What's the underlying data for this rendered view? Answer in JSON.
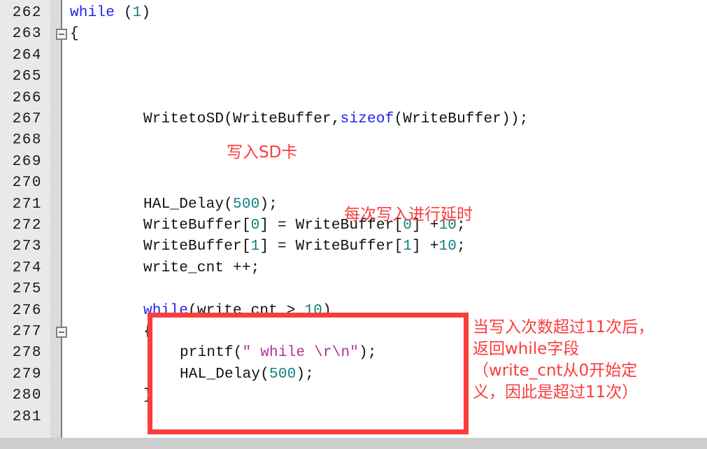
{
  "editor": {
    "gutter_bg": "#e9e9e9",
    "page_bg": "#ffffff",
    "annotation_color": "#fa3c3c",
    "keyword_color": "#2222ee",
    "number_color": "#108080",
    "string_color": "#b0309a",
    "scrollbar_color": "#cdcdcd",
    "line_numbers": [
      "262",
      "263",
      "264",
      "265",
      "266",
      "267",
      "268",
      "269",
      "270",
      "271",
      "272",
      "273",
      "274",
      "275",
      "276",
      "277",
      "278",
      "279",
      "280",
      "281"
    ],
    "fold_markers": [
      {
        "line": "263"
      },
      {
        "line": "277"
      }
    ],
    "lines": [
      {
        "num": "262",
        "indent": 0,
        "tokens": [
          {
            "t": "kw",
            "v": "while"
          },
          {
            "t": "plain",
            "v": " ("
          },
          {
            "t": "num",
            "v": "1"
          },
          {
            "t": "plain",
            "v": ")"
          }
        ]
      },
      {
        "num": "263",
        "indent": 0,
        "tokens": [
          {
            "t": "plain",
            "v": "{"
          }
        ]
      },
      {
        "num": "264",
        "indent": 0,
        "tokens": []
      },
      {
        "num": "265",
        "indent": 0,
        "tokens": []
      },
      {
        "num": "266",
        "indent": 0,
        "tokens": []
      },
      {
        "num": "267",
        "indent": 8,
        "tokens": [
          {
            "t": "plain",
            "v": "WritetoSD(WriteBuffer,"
          },
          {
            "t": "kw",
            "v": "sizeof"
          },
          {
            "t": "plain",
            "v": "(WriteBuffer));"
          }
        ]
      },
      {
        "num": "268",
        "indent": 0,
        "tokens": []
      },
      {
        "num": "269",
        "indent": 0,
        "tokens": []
      },
      {
        "num": "270",
        "indent": 0,
        "tokens": []
      },
      {
        "num": "271",
        "indent": 8,
        "tokens": [
          {
            "t": "plain",
            "v": "HAL_Delay("
          },
          {
            "t": "num",
            "v": "500"
          },
          {
            "t": "plain",
            "v": ");"
          }
        ]
      },
      {
        "num": "272",
        "indent": 8,
        "tokens": [
          {
            "t": "plain",
            "v": "WriteBuffer["
          },
          {
            "t": "num",
            "v": "0"
          },
          {
            "t": "plain",
            "v": "] = WriteBuffer["
          },
          {
            "t": "num",
            "v": "0"
          },
          {
            "t": "plain",
            "v": "] +"
          },
          {
            "t": "num",
            "v": "10"
          },
          {
            "t": "plain",
            "v": ";"
          }
        ]
      },
      {
        "num": "273",
        "indent": 8,
        "tokens": [
          {
            "t": "plain",
            "v": "WriteBuffer["
          },
          {
            "t": "num",
            "v": "1"
          },
          {
            "t": "plain",
            "v": "] = WriteBuffer["
          },
          {
            "t": "num",
            "v": "1"
          },
          {
            "t": "plain",
            "v": "] +"
          },
          {
            "t": "num",
            "v": "10"
          },
          {
            "t": "plain",
            "v": ";"
          }
        ]
      },
      {
        "num": "274",
        "indent": 8,
        "tokens": [
          {
            "t": "plain",
            "v": "write_cnt ++;"
          }
        ]
      },
      {
        "num": "275",
        "indent": 0,
        "tokens": []
      },
      {
        "num": "276",
        "indent": 8,
        "tokens": [
          {
            "t": "kw",
            "v": "while"
          },
          {
            "t": "plain",
            "v": "(write_cnt > "
          },
          {
            "t": "num",
            "v": "10"
          },
          {
            "t": "plain",
            "v": ")"
          }
        ]
      },
      {
        "num": "277",
        "indent": 8,
        "tokens": [
          {
            "t": "plain",
            "v": "{"
          }
        ]
      },
      {
        "num": "278",
        "indent": 12,
        "tokens": [
          {
            "t": "plain",
            "v": "printf("
          },
          {
            "t": "str",
            "v": "\" while \\r\\n\""
          },
          {
            "t": "plain",
            "v": ");"
          }
        ]
      },
      {
        "num": "279",
        "indent": 12,
        "tokens": [
          {
            "t": "plain",
            "v": "HAL_Delay("
          },
          {
            "t": "num",
            "v": "500"
          },
          {
            "t": "plain",
            "v": ");"
          }
        ]
      },
      {
        "num": "280",
        "indent": 8,
        "tokens": [
          {
            "t": "plain",
            "v": "}"
          }
        ]
      },
      {
        "num": "281",
        "indent": 0,
        "tokens": []
      }
    ],
    "annotations": [
      {
        "id": "write-sd-note",
        "text": "写入SD卡"
      },
      {
        "id": "delay-note",
        "text": "每次写入进行延时"
      },
      {
        "id": "while-note-l1",
        "text": "当写入次数超过11次后，"
      },
      {
        "id": "while-note-l2",
        "text": "返回while字段"
      },
      {
        "id": "while-note-l3",
        "text": "（write_cnt从0开始定"
      },
      {
        "id": "while-note-l4",
        "text": "义，因此是超过11次）"
      }
    ],
    "highlight_box": {
      "label": "while-loop-highlight"
    }
  }
}
